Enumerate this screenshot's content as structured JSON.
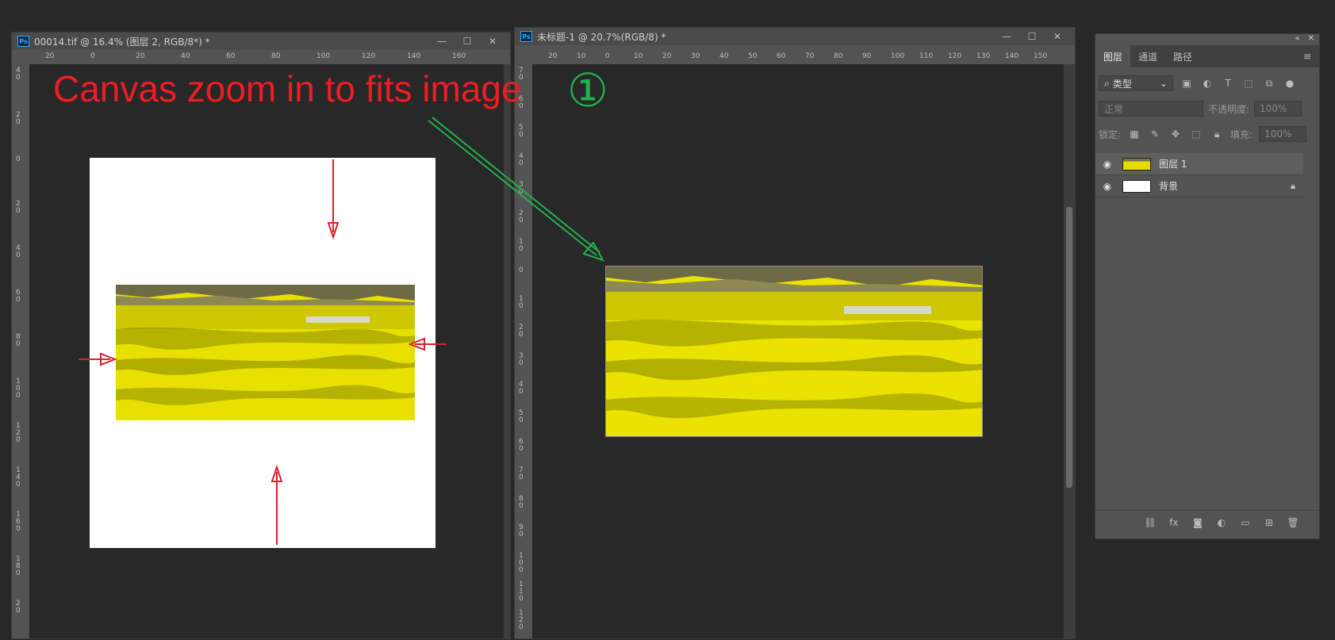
{
  "window1": {
    "title": "00014.tif @ 16.4% (图层 2, RGB/8*) *",
    "hruler_ticks": [
      "20",
      "0",
      "20",
      "40",
      "60",
      "80",
      "100",
      "120",
      "140",
      "160"
    ],
    "vruler_ticks": [
      "4\n0",
      "2\n0",
      "0",
      "2\n0",
      "4\n0",
      "6\n0",
      "8\n0",
      "1\n0\n0",
      "1\n2\n0",
      "1\n4\n0",
      "1\n6\n0",
      "1\n8\n0",
      "2\n0"
    ]
  },
  "window2": {
    "title": "未标题-1 @ 20.7%(RGB/8) *",
    "hruler_ticks": [
      "20",
      "10",
      "0",
      "10",
      "20",
      "30",
      "40",
      "50",
      "60",
      "70",
      "80",
      "90",
      "100",
      "110",
      "120",
      "130",
      "140",
      "150"
    ],
    "vruler_ticks": [
      "7\n0",
      "6\n0",
      "5\n0",
      "4\n0",
      "3\n0",
      "2\n0",
      "1\n0",
      "0",
      "1\n0",
      "2\n0",
      "3\n0",
      "4\n0",
      "5\n0",
      "6\n0",
      "7\n0",
      "8\n0",
      "9\n0",
      "1\n0\n0",
      "1\n1\n0",
      "1\n2\n0"
    ]
  },
  "window_controls": {
    "minimize": "—",
    "maximize": "☐",
    "close": "✕"
  },
  "annotation": {
    "text": "Canvas  zoom in to fits image",
    "marker": "①",
    "text_color": "#ee1c25",
    "marker_color": "#22b14c"
  },
  "layers_panel": {
    "collapse_icon": "«",
    "close_icon": "✕",
    "tabs": [
      "图层",
      "通道",
      "路径"
    ],
    "menu_icon": "≡",
    "filter_label": "类型",
    "blend_mode": "正常",
    "opacity_label": "不透明度:",
    "opacity_value": "100%",
    "lock_label": "锁定:",
    "fill_label": "填充:",
    "fill_value": "100%",
    "layers": [
      {
        "name": "图层 1",
        "visible": true,
        "selected": true
      },
      {
        "name": "背景",
        "visible": true,
        "locked": true
      }
    ]
  },
  "colors": {
    "app_bg": "#282828",
    "chrome": "#535353",
    "field_yellow": "#f2ea05"
  }
}
